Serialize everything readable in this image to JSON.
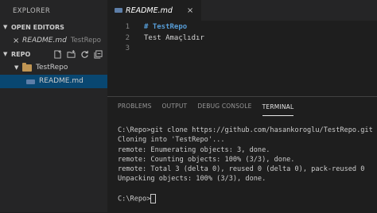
{
  "sidebar": {
    "title": "EXPLORER",
    "open_editors": {
      "label": "OPEN EDITORS",
      "items": [
        {
          "name": "README.md",
          "dir": "TestRepo"
        }
      ]
    },
    "repo": {
      "label": "REPO",
      "actions": [
        "new-file-icon",
        "new-folder-icon",
        "refresh-icon",
        "collapse-all-icon"
      ],
      "folder": "TestRepo",
      "file": "README.md"
    }
  },
  "editor": {
    "tab": {
      "label": "README.md",
      "close": "×"
    },
    "lines": [
      {
        "num": "1",
        "text": "# TestRepo"
      },
      {
        "num": "2",
        "text": "Test Amaçlıdır"
      },
      {
        "num": "3",
        "text": ""
      }
    ]
  },
  "panel": {
    "tabs": [
      "PROBLEMS",
      "OUTPUT",
      "DEBUG CONSOLE",
      "TERMINAL"
    ],
    "active_tab": "TERMINAL",
    "terminal_lines": [
      "C:\\Repo>git clone https://github.com/hasankoroglu/TestRepo.git",
      "Cloning into 'TestRepo'...",
      "remote: Enumerating objects: 3, done.",
      "remote: Counting objects: 100% (3/3), done.",
      "remote: Total 3 (delta 0), reused 0 (delta 0), pack-reused 0",
      "Unpacking objects: 100% (3/3), done.",
      "",
      "C:\\Repo>"
    ]
  },
  "colors": {
    "selection": "#094771",
    "heading": "#569cd6",
    "folder": "#c09553"
  }
}
